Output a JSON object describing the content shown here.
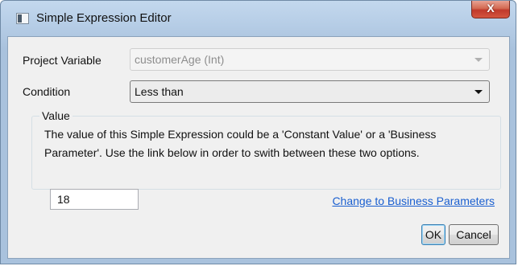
{
  "window": {
    "title": "Simple Expression Editor",
    "close_label": "X"
  },
  "form": {
    "project_variable_label": "Project Variable",
    "project_variable_value": "customerAge (Int)",
    "condition_label": "Condition",
    "condition_value": "Less than"
  },
  "value_group": {
    "label": "Value",
    "description_line1": "The value of this Simple Expression could be a 'Constant Value' or a 'Business",
    "description_line2": "Parameter'. Use the link below in order to swith between these two options.",
    "input_value": "18",
    "link_text": "Change to Business Parameters"
  },
  "buttons": {
    "ok_label": "OK",
    "cancel_label": "Cancel"
  },
  "icons": {
    "app": "app-window-icon",
    "close": "close-icon",
    "dropdown": "chevron-down-icon"
  }
}
